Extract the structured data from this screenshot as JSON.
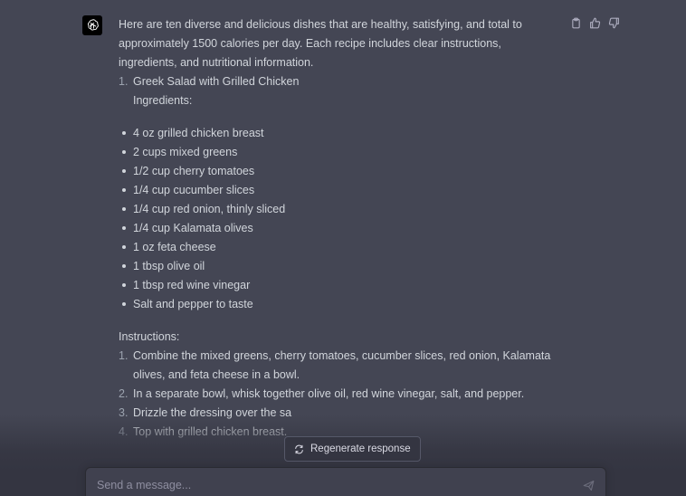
{
  "message": {
    "intro": "Here are ten diverse and delicious dishes that are healthy, satisfying, and total to approximately 1500 calories per day. Each recipe includes clear instructions, ingredients, and nutritional information.",
    "recipe": {
      "number": "1.",
      "title": "Greek Salad with Grilled Chicken",
      "ingredients_label": "Ingredients:",
      "ingredients": [
        "4 oz grilled chicken breast",
        "2 cups mixed greens",
        "1/2 cup cherry tomatoes",
        "1/4 cup cucumber slices",
        "1/4 cup red onion, thinly sliced",
        "1/4 cup Kalamata olives",
        "1 oz feta cheese",
        "1 tbsp olive oil",
        "1 tbsp red wine vinegar",
        "Salt and pepper to taste"
      ],
      "instructions_label": "Instructions:",
      "instructions": [
        {
          "num": "1.",
          "text": "Combine the mixed greens, cherry tomatoes, cucumber slices, red onion, Kalamata olives, and feta cheese in a bowl."
        },
        {
          "num": "2.",
          "text": "In a separate bowl, whisk together olive oil, red wine vinegar, salt, and pepper."
        },
        {
          "num": "3.",
          "text": "Drizzle the dressing over the sa"
        },
        {
          "num": "4.",
          "text": "Top with grilled chicken breast."
        }
      ]
    }
  },
  "actions": {
    "icons": [
      "clipboard-icon",
      "thumbs-up-icon",
      "thumbs-down-icon"
    ]
  },
  "regenerate": {
    "label": "Regenerate response"
  },
  "composer": {
    "placeholder": "Send a message..."
  },
  "colors": {
    "message_bg": "#444654",
    "page_bg": "#343541",
    "text": "#d1d5db",
    "input_bg": "#40414f"
  }
}
